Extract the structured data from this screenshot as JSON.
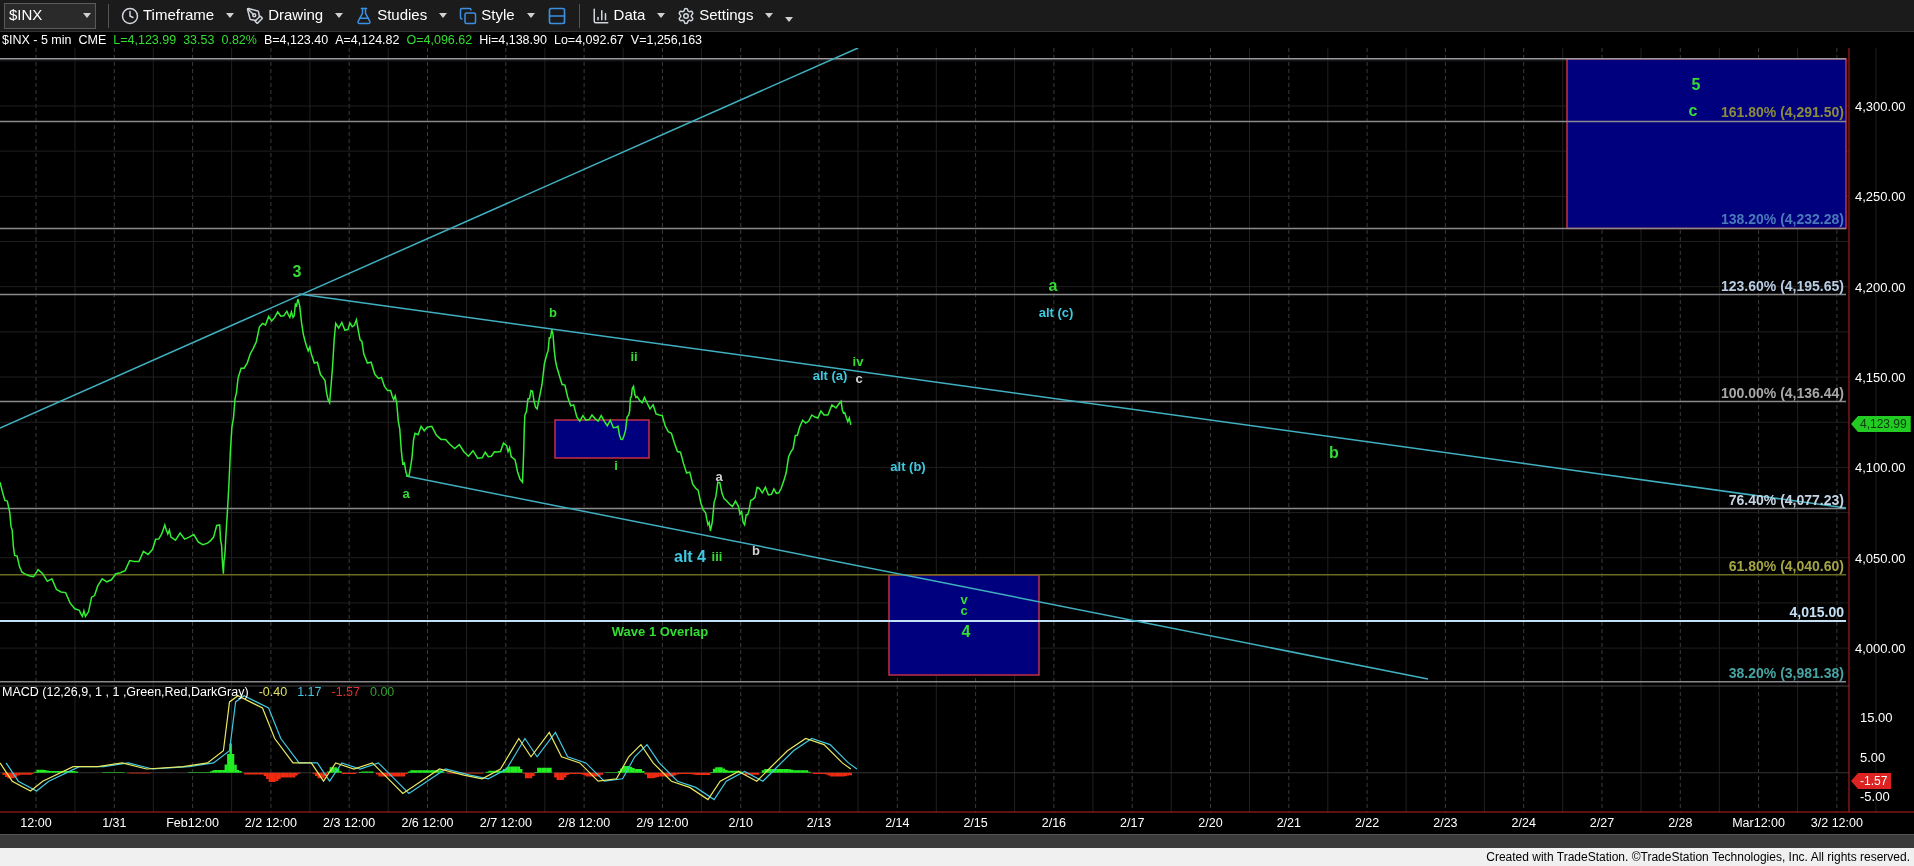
{
  "toolbar": {
    "symbol": "$INX",
    "menus": [
      {
        "label": "Timeframe",
        "kind": "clock"
      },
      {
        "label": "Drawing",
        "kind": "pen"
      },
      {
        "label": "Studies",
        "kind": "flask"
      },
      {
        "label": "Style",
        "kind": "style"
      },
      {
        "label": "Data",
        "kind": "data"
      },
      {
        "label": "Settings",
        "kind": "gear"
      }
    ]
  },
  "quote_line": [
    {
      "text": "$INX - 5 min",
      "color": "#ffffff"
    },
    {
      "text": "CME",
      "color": "#ffffff"
    },
    {
      "text": "L=4,123.99",
      "color": "#33dd33"
    },
    {
      "text": "33.53",
      "color": "#33dd33"
    },
    {
      "text": "0.82%",
      "color": "#33dd33"
    },
    {
      "text": "B=4,123.40",
      "color": "#ffffff"
    },
    {
      "text": "A=4,124.82",
      "color": "#ffffff"
    },
    {
      "text": "O=4,096.62",
      "color": "#33dd33"
    },
    {
      "text": "Hi=4,138.90",
      "color": "#ffffff"
    },
    {
      "text": "Lo=4,092.67",
      "color": "#ffffff"
    },
    {
      "text": "V=1,256,163",
      "color": "#ffffff"
    }
  ],
  "price_axis": {
    "labels": [
      "4,300.00",
      "4,250.00",
      "4,200.00",
      "4,150.00",
      "4,100.00",
      "4,050.00",
      "4,000.00"
    ],
    "last_price": "4,123.99"
  },
  "fib_levels": [
    {
      "label": "161.80% (4,291.50)"
    },
    {
      "label": "138.20% (4,232.28)"
    },
    {
      "label": "123.60% (4,195.65)"
    },
    {
      "label": "100.00% (4,136.44)"
    },
    {
      "label": "76.40% (4,077.23)"
    },
    {
      "label": "61.80% (4,040.60)"
    },
    {
      "label": "4,015.00"
    },
    {
      "label": "38.20% (3,981.38)"
    }
  ],
  "annotations": [
    {
      "text": "3",
      "kind": "major",
      "color": "#33dd33"
    },
    {
      "text": "b",
      "kind": "minor",
      "color": "#33dd33"
    },
    {
      "text": "a",
      "kind": "minor",
      "color": "#33dd33"
    },
    {
      "text": "ii",
      "kind": "minor",
      "color": "#33dd33"
    },
    {
      "text": "i",
      "kind": "minor",
      "color": "#33dd33"
    },
    {
      "text": "a",
      "kind": "minor",
      "color": "#d0d0d0"
    },
    {
      "text": "b",
      "kind": "minor",
      "color": "#d0d0d0"
    },
    {
      "text": "alt 4",
      "kind": "major",
      "color": "#40c8e0"
    },
    {
      "text": "iii",
      "kind": "minor",
      "color": "#33dd33"
    },
    {
      "text": "alt (a)",
      "kind": "minor",
      "color": "#40c8e0"
    },
    {
      "text": "iv",
      "kind": "minor",
      "color": "#33dd33"
    },
    {
      "text": "c",
      "kind": "minor",
      "color": "#d0d0d0"
    },
    {
      "text": "alt (b)",
      "kind": "minor",
      "color": "#40c8e0"
    },
    {
      "text": "a",
      "kind": "major",
      "color": "#33dd33"
    },
    {
      "text": "alt (c)",
      "kind": "minor",
      "color": "#40c8e0"
    },
    {
      "text": "b",
      "kind": "major",
      "color": "#33dd33"
    },
    {
      "text": "5",
      "kind": "major",
      "color": "#33dd33"
    },
    {
      "text": "c",
      "kind": "major",
      "color": "#33dd33"
    },
    {
      "text": "v",
      "kind": "minor",
      "color": "#33dd33"
    },
    {
      "text": "c",
      "kind": "minor",
      "color": "#33dd33"
    },
    {
      "text": "4",
      "kind": "major",
      "color": "#33dd33"
    },
    {
      "text": "Wave 1 Overlap",
      "kind": "minor",
      "color": "#33dd33"
    }
  ],
  "macd": {
    "title": "MACD (12,26,9, 1 , 1 ,Green,Red,DarkGray)",
    "values": [
      {
        "text": "-0.40",
        "color": "#e0e060"
      },
      {
        "text": "1.17",
        "color": "#40c8e0"
      },
      {
        "text": "-1.57",
        "color": "#e03030"
      },
      {
        "text": "0.00",
        "color": "#30a030"
      }
    ],
    "axis_labels": [
      "15.00",
      "5.00",
      "-5.00"
    ],
    "last_value": "-1.57"
  },
  "date_axis": [
    "12:00",
    "1/31",
    "Feb12:00",
    "2/2 12:00",
    "2/3 12:00",
    "2/6 12:00",
    "2/7 12:00",
    "2/8 12:00",
    "2/9 12:00",
    "2/10",
    "2/13",
    "2/14",
    "2/15",
    "2/16",
    "2/17",
    "2/20",
    "2/21",
    "2/22",
    "2/23",
    "2/24",
    "2/27",
    "2/28",
    "Mar12:00",
    "3/2 12:00"
  ],
  "footer": "Created with TradeStation. ©TradeStation Technologies, Inc. All rights reserved."
}
